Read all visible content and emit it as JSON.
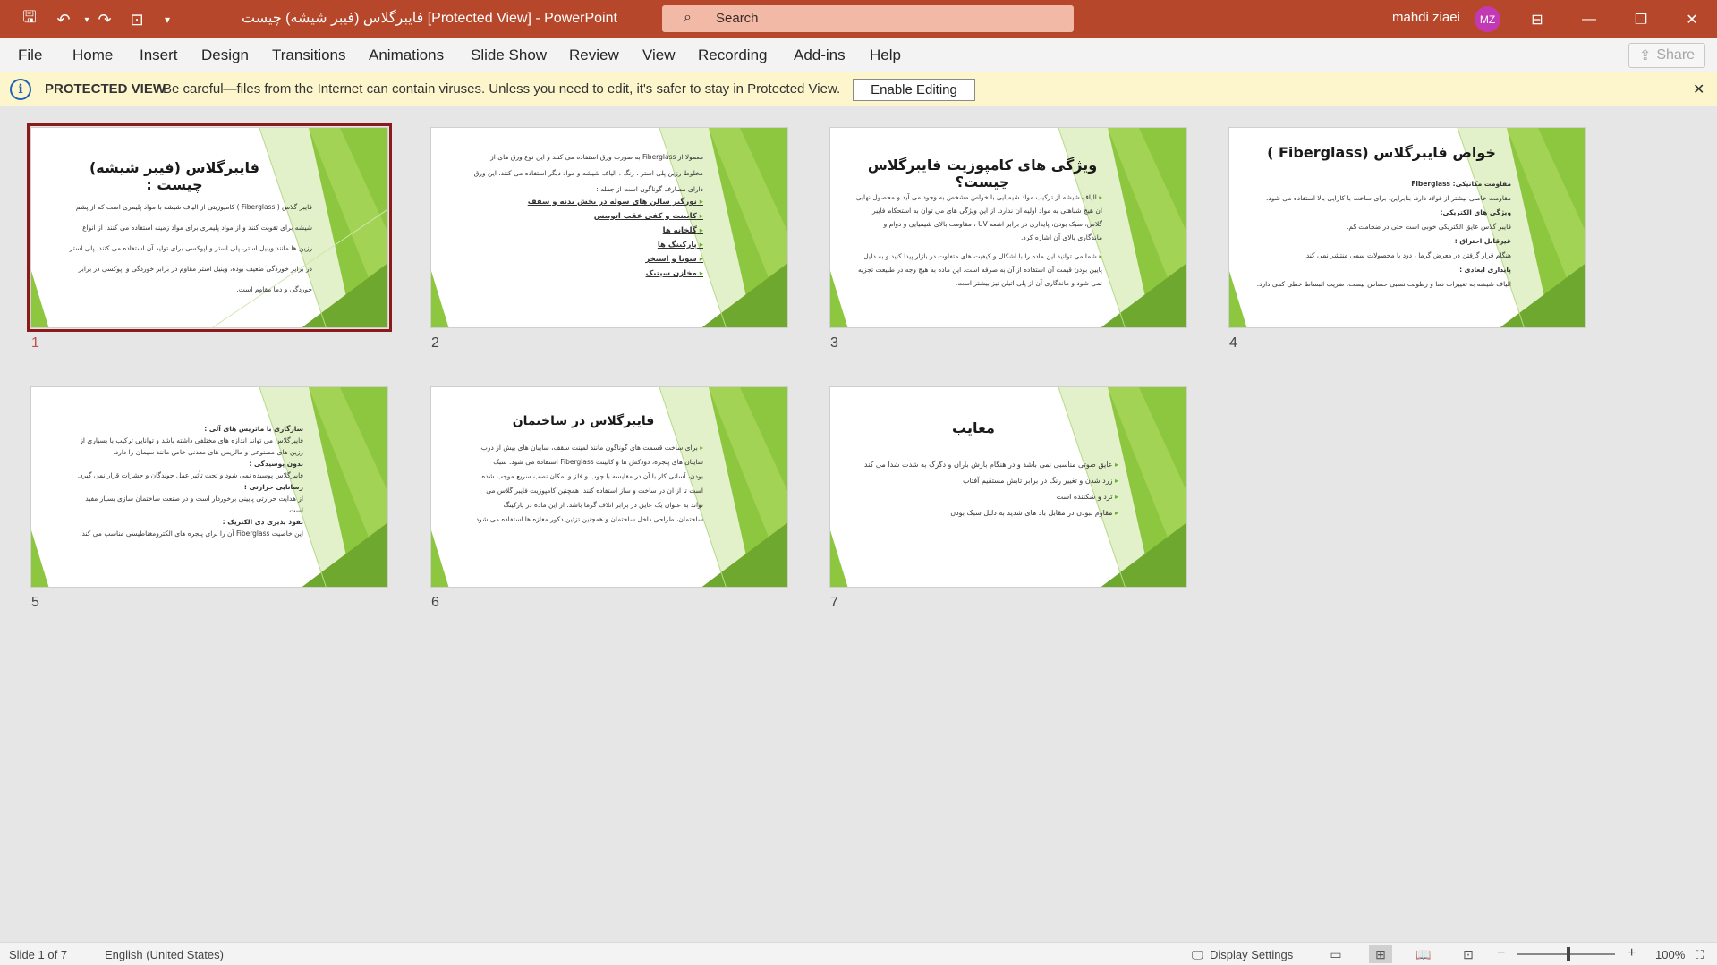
{
  "window": {
    "title": "فایبرگلاس (فیبر شیشه) چیست [Protected View]  -  PowerPoint",
    "search_placeholder": "Search",
    "user_name": "mahdi ziaei",
    "user_initials": "MZ"
  },
  "menu": {
    "tabs": [
      "File",
      "Home",
      "Insert",
      "Design",
      "Transitions",
      "Animations",
      "Slide Show",
      "Review",
      "View",
      "Recording",
      "Add-ins",
      "Help"
    ],
    "share_label": "Share"
  },
  "protected_view": {
    "title": "PROTECTED VIEW",
    "message": "Be careful—files from the Internet can contain viruses. Unless you need to edit, it's safer to stay in Protected View.",
    "button": "Enable Editing"
  },
  "slides": [
    {
      "number": "1",
      "title": "فایبرگلاس (فیبر شیشه) چیست :",
      "body": [
        "فایبر گلاس ( Fiberglass ) کامپوزیتی از الیاف شیشه با مواد پلیمری است که از پشم",
        "شیشه برای تقویت کنند و از مواد پلیمری برای مواد زمینه استفاده می کنند. از انواع",
        "رزین ها مانند وینیل استر، پلی استر و اپوکسی برای تولید آن استفاده می کنند. پلی استر",
        "در برابر خوردگی ضعیف بوده، وینیل استر مقاوم در برابر خوردگی و اپوکسی در برابر",
        "خوردگی          و          دما          مقاوم          است."
      ]
    },
    {
      "number": "2",
      "intro": [
        "معمولا از Fiberglass به صورت ورق استفاده می کنند و این نوع ورق های از",
        "مخلوط رزین پلی استر ، رنگ ، الیاف شیشه و مواد دیگر استفاده می کنند. این ورق",
        "دارای مصارف گوناگون است از جمله :"
      ],
      "items": [
        "نورگیر سالن های سوله در بخش بدنه و سقف",
        "کابینت و کفی عقب اتوبیس",
        "گلخانه ها",
        "پارکینگ ها",
        "سونا و استخر",
        "مخازن سپتیک"
      ]
    },
    {
      "number": "3",
      "title": "ویژگی های کامپوزیت فایبرگلاس چیست؟",
      "body": [
        "الیاف شیشه از ترکیب مواد شیمیایی با خواص مشخص به وجود می آید و محصول نهایی",
        "آن هیچ شباهتی به مواد اولیه آن ندارد. از این ویژگی های می توان به استحکام فایبر",
        "گلاس، سبک بودن، پایداری در برابر اشعه UV ، مقاومت بالای شیمیایی و دوام و",
        "ماندگاری بالای آن اشاره کرد.",
        "شما می توانید این ماده را با اشکال و کیفیت های متفاوت در بازار پیدا کنید و به دلیل",
        "پایین بودن قیمت آن استفاده از آن به صرفه است. این ماده به هیچ وجه در طبیعت تجزیه",
        "نمی شود و ماندگاری آن از پلی اتیلن نیز بیشتر است."
      ]
    },
    {
      "number": "4",
      "title": "خواص فایبرگلاس (Fiberglass )",
      "body": [
        "مقاومت مکانیکی: Fiberglass",
        "مقاومت خاصی بیشتر از فولاد دارد. بنابراین، برای ساخت با کارایی بالا استفاده می شود.",
        "ویژگی های الکتریکی:",
        "فایبر گلاس عایق الکتریکی خوبی است حتی در ضخامت کم.",
        "غیرقابل احتراق :",
        "هنگام قرار گرفتن در معرض گرما ، دود یا محصولات سمی منتشر نمی کند.",
        "پایداری ابعادی :",
        "الیاف شیشه به تغییرات دما و رطوبت نسبی حساس نیست. ضریب انبساط خطی کمی دارد."
      ]
    },
    {
      "number": "5",
      "body": [
        "سازگاری با ماتریس های آلی :",
        "فایبرگلاس می تواند اندازه های مختلفی داشته باشد و توانایی ترکیب با بسیاری از",
        "رزین های مصنوعی و مالریس های معدنی خاص مانند سیمان را دارد.",
        "بدون پوسیدگی :",
        "فایبرگلاس پوسیده نمی شود و تحت تأثیر عمل جوندگان و حشرات قرار نمی گیرد.",
        "رسانایی حرارتی :",
        "از هدایت حرارتی پایینی برخوردار است و در صنعت ساختمان سازی بسیار مفید",
        "است.",
        "نفوذ پذیری دی الکتریک :",
        "این خاصیت Fiberglass آن را برای پنجره های الکترومغناطیسی مناسب می کند."
      ]
    },
    {
      "number": "6",
      "title": "فایبرگلاس در ساختمان",
      "body": [
        "برای ساخت قسمت های گوناگون مانند لمینت سقف، سایبان های بیش از درب،",
        "سایبان های پنجره، دودکش ها و کابینت Fiberglass استفاده می شود. سبک",
        "بودن، آسانی کار با آن در مقایسه با چوب و فلز و امکان نصب سریع موجب شده",
        "است تا از آن در ساخت و ساز استفاده کنند. همچنین کامپوزیت فایبر گلاس می",
        "تواند به عنوان یک عایق در برابر اتلاف گرما باشد. از این ماده در پارکینگ",
        "ساختمان، طراحی داخل ساختمان و همچنین تزئین دکور مغازه ها استفاده می شود."
      ]
    },
    {
      "number": "7",
      "title": "معایب",
      "body": [
        "عایق صوتی مناسبی نمی باشد و در هنگام بارش باران و دگرگ به شدت شدا می کند",
        "زرد شدن و تغییر رنگ در برابر تابش مستقیم آفتاب",
        "ترد و شکننده است",
        "مقاوم نبودن در مقابل باد های شدید به دلیل سبک بودن"
      ]
    }
  ],
  "status_bar": {
    "slide_info": "Slide 1 of 7",
    "language": "English (United States)",
    "display_settings": "Display Settings",
    "zoom": "100%"
  }
}
